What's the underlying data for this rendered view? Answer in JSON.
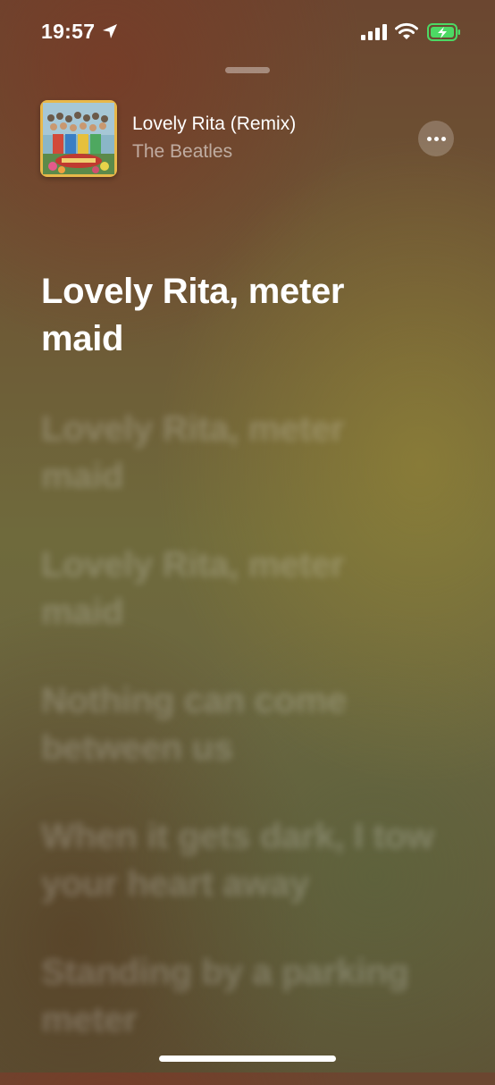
{
  "status_bar": {
    "time": "19:57",
    "icons": [
      "location-arrow-icon",
      "cellular-signal-icon",
      "wifi-icon",
      "battery-charging-icon"
    ],
    "battery_color": "#4cd964"
  },
  "now_playing": {
    "title": "Lovely Rita (Remix)",
    "artist": "The Beatles",
    "album_art_border_color": "#e8b84a",
    "more_icon": "ellipsis-icon"
  },
  "lyrics": {
    "current": "Lovely Rita, meter maid",
    "upcoming": [
      "Lovely Rita, meter maid",
      "Lovely Rita, meter maid",
      "Nothing can come between us",
      "When it gets dark, I tow your heart away",
      "Standing by a parking meter"
    ]
  }
}
